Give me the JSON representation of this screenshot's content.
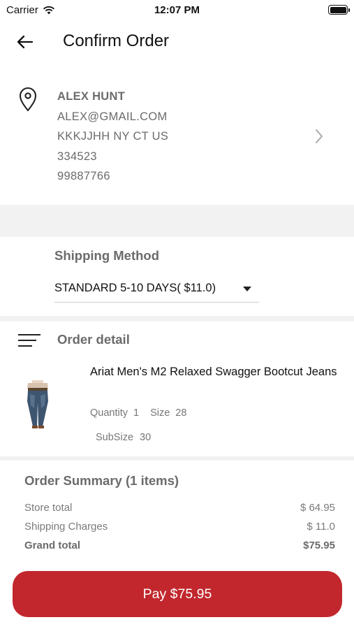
{
  "status_bar": {
    "carrier": "Carrier",
    "time": "12:07 PM"
  },
  "header": {
    "title": "Confirm Order"
  },
  "address": {
    "name": "ALEX HUNT",
    "email": "ALEX@GMAIL.COM",
    "location": "KKKJJHH NY CT US",
    "zip": "334523",
    "phone": "99887766"
  },
  "shipping": {
    "label": "Shipping Method",
    "selected": "STANDARD 5-10 DAYS( $11.0)"
  },
  "order_detail": {
    "title": "Order detail",
    "item": {
      "name": "Ariat Men's M2 Relaxed Swagger Bootcut Jeans",
      "quantity_label": "Quantity",
      "quantity": "1",
      "size_label": "Size",
      "size": "28",
      "subsize_label": "SubSize",
      "subsize": "30"
    }
  },
  "summary": {
    "title": "Order Summary (1 items)",
    "store_total_label": "Store total",
    "store_total": "$ 64.95",
    "shipping_label": "Shipping Charges",
    "shipping": "$ 11.0",
    "grand_total_label": "Grand total",
    "grand_total": "$75.95"
  },
  "pay_button": {
    "label": "Pay $75.95"
  },
  "colors": {
    "accent": "#c1272d",
    "muted_text": "#6b6b6b",
    "band": "#f2f2f2"
  }
}
